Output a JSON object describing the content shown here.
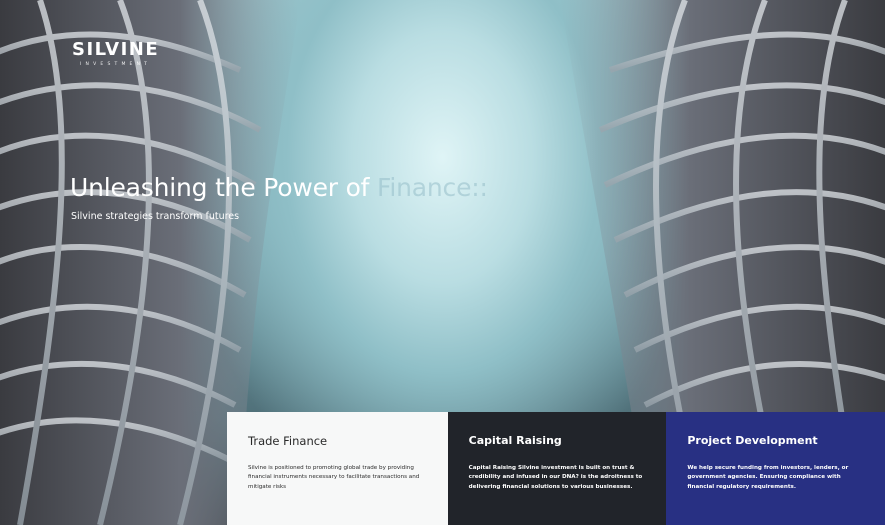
{
  "brand": {
    "name": "SILVINE",
    "sub": "INVESTMENT"
  },
  "hero": {
    "headline_main": "Unleashing the Power of ",
    "headline_faded": "Finance::",
    "tagline": "Silvine strategies transform futures"
  },
  "cards": [
    {
      "title": "Trade Finance",
      "text": "Silvine is positioned to promoting global trade by providing financial instruments necessary to facilitate transactions and mitigate risks"
    },
    {
      "title": "Capital Raising",
      "text": "Capital Raising Silvine investment is built on trust & credibility and infused in our DNA? is the adroitness to delivering financial solutions to various businesses."
    },
    {
      "title": "Project Development",
      "text": "We help secure funding from investors, lenders, or government agencies. Ensuring compliance with financial regulatory requirements."
    }
  ],
  "colors": {
    "card_light": "#f7f8f8",
    "card_dark": "#21242a",
    "card_blue": "#283083",
    "sky": "#b9dde2"
  }
}
